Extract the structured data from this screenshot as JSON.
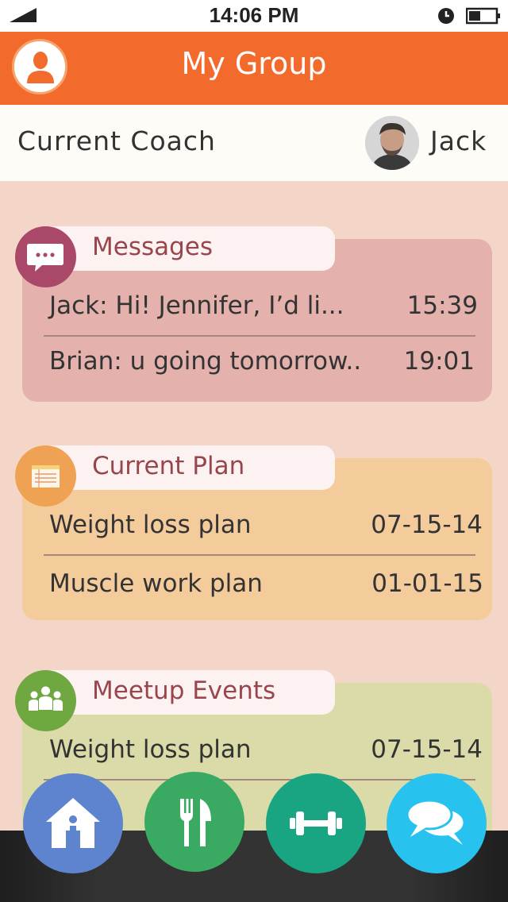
{
  "status_bar": {
    "time": "14:06 PM"
  },
  "header": {
    "title": "My Group"
  },
  "coach": {
    "label": "Current Coach",
    "name": "Jack"
  },
  "messages": {
    "title": "Messages",
    "items": [
      {
        "text": "Jack:  Hi! Jennifer, I’d li...",
        "time": "15:39"
      },
      {
        "text": "Brian: u going tomorrow..",
        "time": "19:01"
      }
    ]
  },
  "plan": {
    "title": "Current Plan",
    "items": [
      {
        "name": "Weight loss plan",
        "date": "07-15-14"
      },
      {
        "name": "Muscle work plan",
        "date": "01-01-15"
      }
    ]
  },
  "events": {
    "title": "Meetup Events",
    "items": [
      {
        "name": "Weight loss plan",
        "date": "07-15-14"
      }
    ]
  },
  "nav": {
    "items": [
      {
        "icon": "home-icon"
      },
      {
        "icon": "fork-knife-icon"
      },
      {
        "icon": "dumbbell-icon"
      },
      {
        "icon": "chat-bubbles-icon"
      }
    ]
  },
  "colors": {
    "header": "#f26a2c",
    "messages_card": "#e4b1ad",
    "plan_card": "#f4cc9c",
    "events_card": "#dadba8",
    "label_text": "#98464c"
  }
}
